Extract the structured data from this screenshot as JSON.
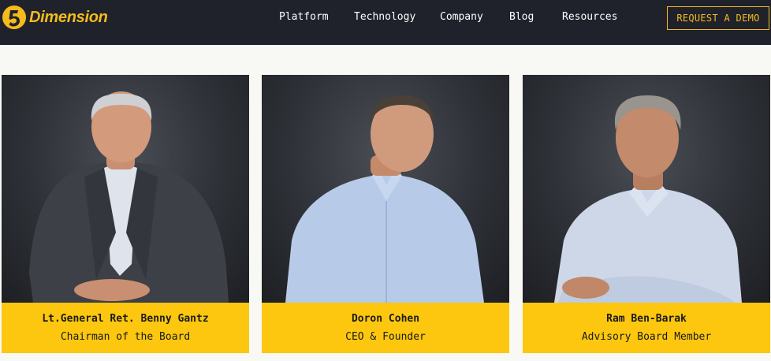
{
  "brand": {
    "name": "Dimension",
    "accent": "#f5bb1d",
    "nav_bg": "#1f222b",
    "card_caption_bg": "#fcc70e"
  },
  "nav": {
    "items": [
      {
        "label": "Platform"
      },
      {
        "label": "Technology"
      },
      {
        "label": "Company"
      },
      {
        "label": "Blog"
      },
      {
        "label": "Resources"
      }
    ],
    "cta_label": "REQUEST A DEMO"
  },
  "team": [
    {
      "name": "Lt.General Ret. Benny Gantz",
      "role": "Chairman of the Board"
    },
    {
      "name": "Doron Cohen",
      "role": "CEO & Founder"
    },
    {
      "name": "Ram Ben-Barak",
      "role": "Advisory Board Member"
    }
  ]
}
